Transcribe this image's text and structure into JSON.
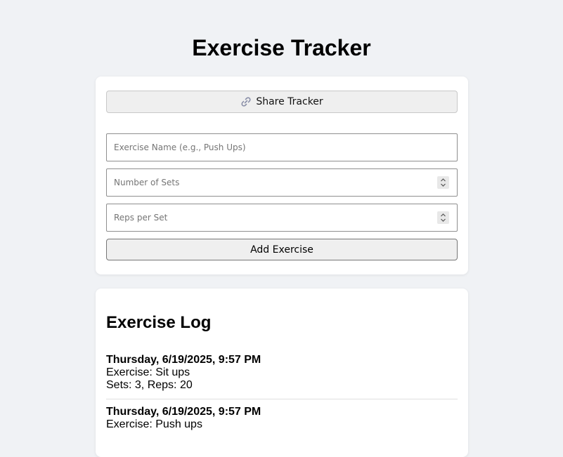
{
  "page": {
    "title": "Exercise Tracker"
  },
  "form": {
    "share_label": "Share Tracker",
    "exercise_name_placeholder": "Exercise Name (e.g., Push Ups)",
    "sets_placeholder": "Number of Sets",
    "reps_placeholder": "Reps per Set",
    "add_label": "Add Exercise"
  },
  "log": {
    "title": "Exercise Log",
    "entries": [
      {
        "date": "Thursday, 6/19/2025, 9:57 PM",
        "exercise": "Exercise: Sit ups",
        "details": "Sets: 3, Reps: 20"
      },
      {
        "date": "Thursday, 6/19/2025, 9:57 PM",
        "exercise": "Exercise: Push ups",
        "details": ""
      }
    ]
  },
  "colors": {
    "background": "#f0f2f5",
    "card": "#ffffff",
    "button": "#efefef"
  }
}
